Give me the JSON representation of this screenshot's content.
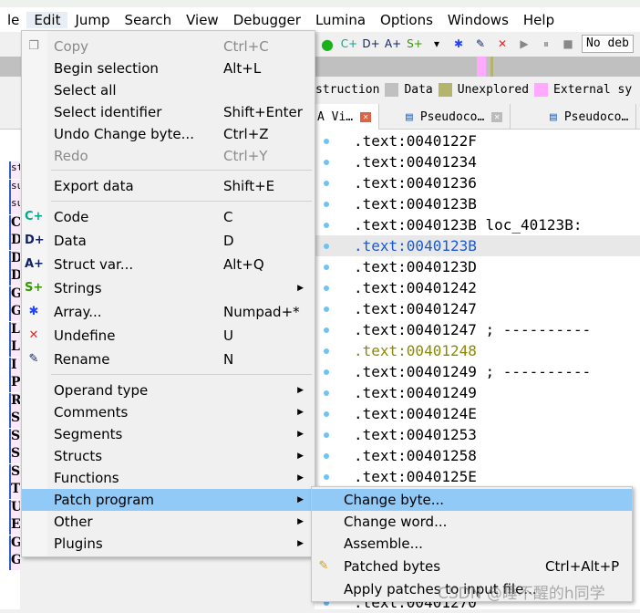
{
  "menubar": [
    "le",
    "Edit",
    "Jump",
    "Search",
    "View",
    "Debugger",
    "Lumina",
    "Options",
    "Windows",
    "Help"
  ],
  "toolbar": {
    "debugger_select": "No deb"
  },
  "legend": [
    {
      "label": "struction",
      "color": null
    },
    {
      "label": "Data",
      "color": "#c0c0c0"
    },
    {
      "label": "Unexplored",
      "color": "#b4b46c"
    },
    {
      "label": "External sy",
      "color": "#ffaaff"
    }
  ],
  "tabs": [
    {
      "label": "A Vi…"
    },
    {
      "label": "Pseudoco…"
    },
    {
      "label": "Pseudoco…"
    }
  ],
  "left_panel": {
    "tab": "Fu",
    "header": "unc",
    "items": [
      "st",
      "su",
      "su",
      "C",
      "D",
      "D",
      "D",
      "G",
      "G",
      "L",
      "L",
      "I",
      "P",
      "R",
      "S",
      "S",
      "S",
      "S",
      "T",
      "U",
      "E",
      "G",
      "G"
    ]
  },
  "code_lines": [
    ".text:0040122F",
    ".text:00401234",
    ".text:00401236",
    ".text:0040123B",
    ".text:0040123B loc_40123B:",
    ".text:0040123B",
    ".text:0040123D",
    ".text:00401242",
    ".text:00401247",
    ".text:00401247 ; ----------",
    ".text:00401248",
    ".text:00401249 ; ----------",
    ".text:00401249",
    ".text:0040124E",
    ".text:00401253",
    ".text:00401258",
    ".text:0040125E",
    ".text:00401270"
  ],
  "edit_menu": [
    {
      "label": "Copy",
      "shortcut": "Ctrl+C",
      "disabled": true,
      "icon": "copy-icon"
    },
    {
      "label": "Begin selection",
      "shortcut": "Alt+L"
    },
    {
      "label": "Select all",
      "shortcut": ""
    },
    {
      "label": "Select identifier",
      "shortcut": "Shift+Enter"
    },
    {
      "label": "Undo Change byte...",
      "shortcut": "Ctrl+Z"
    },
    {
      "label": "Redo",
      "shortcut": "Ctrl+Y",
      "disabled": true
    },
    {
      "label": "Export data",
      "shortcut": "Shift+E"
    },
    {
      "label": "Code",
      "shortcut": "C",
      "icon": "code-icon"
    },
    {
      "label": "Data",
      "shortcut": "D",
      "icon": "data-icon"
    },
    {
      "label": "Struct var...",
      "shortcut": "Alt+Q",
      "icon": "struct-icon"
    },
    {
      "label": "Strings",
      "shortcut": "",
      "submenu": true,
      "icon": "strings-icon"
    },
    {
      "label": "Array...",
      "shortcut": "Numpad+*",
      "icon": "array-icon"
    },
    {
      "label": "Undefine",
      "shortcut": "U",
      "icon": "undefine-icon"
    },
    {
      "label": "Rename",
      "shortcut": "N",
      "icon": "rename-icon"
    },
    {
      "label": "Operand type",
      "submenu": true
    },
    {
      "label": "Comments",
      "submenu": true
    },
    {
      "label": "Segments",
      "submenu": true
    },
    {
      "label": "Structs",
      "submenu": true
    },
    {
      "label": "Functions",
      "submenu": true
    },
    {
      "label": "Patch program",
      "submenu": true,
      "selected": true
    },
    {
      "label": "Other",
      "submenu": true
    },
    {
      "label": "Plugins",
      "submenu": true
    }
  ],
  "patch_menu": [
    {
      "label": "Change byte...",
      "shortcut": "",
      "selected": true
    },
    {
      "label": "Change word...",
      "shortcut": ""
    },
    {
      "label": "Assemble...",
      "shortcut": ""
    },
    {
      "label": "Patched bytes",
      "shortcut": "Ctrl+Alt+P",
      "icon": "patched-bytes-icon"
    },
    {
      "label": "Apply patches to input file...",
      "shortcut": ""
    }
  ],
  "watermark": "CSDN @睡不醒的h同学",
  "colors": {
    "selection": "#91c9f7",
    "highlight_line": "#e8e8e8"
  }
}
